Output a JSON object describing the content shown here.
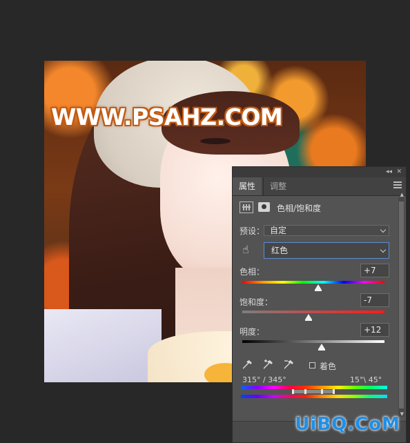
{
  "canvas": {
    "watermark": "WWW.PSAHZ.COM"
  },
  "panel": {
    "tabs": [
      {
        "label": "属性",
        "active": true
      },
      {
        "label": "调整",
        "active": false
      }
    ],
    "adjustment_title": "色相/饱和度",
    "preset": {
      "label": "预设：",
      "value": "自定"
    },
    "channel": {
      "value": "红色"
    },
    "hue": {
      "label": "色相：",
      "value": "+7",
      "level_fraction": 0.52
    },
    "saturation": {
      "label": "饱和度：",
      "value": "-7",
      "level_fraction": 0.46
    },
    "lightness": {
      "label": "明度：",
      "value": "+12",
      "level_fraction": 0.56
    },
    "colorize": {
      "label": "着色",
      "checked": false
    },
    "range": {
      "left": "315° / 345°",
      "right": "15°\\ 45°"
    }
  },
  "icons": {
    "hand": "hand-targeted-adjustment-icon",
    "eyedroppers": [
      "eyedropper-icon",
      "eyedropper-plus-icon",
      "eyedropper-minus-icon"
    ]
  },
  "site_logo": "UiBQ.CoM",
  "colors": {
    "panel_bg": "#535353",
    "canvas_bg": "#282828",
    "accent_focus": "#5a8fd8",
    "logo_blue": "#1e8fe8"
  }
}
